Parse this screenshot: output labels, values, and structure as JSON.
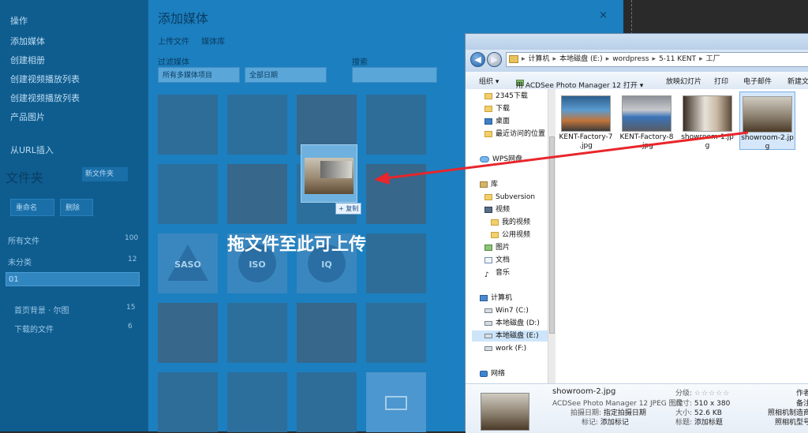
{
  "wp": {
    "sidebar_items": [
      "操作",
      "添加媒体",
      "创建相册",
      "创建视频播放列表",
      "创建视频播放列表",
      "产品图片",
      "从URL插入"
    ],
    "title": "添加媒体",
    "close": "×",
    "tabs": [
      "上传文件",
      "媒体库"
    ],
    "filter_label": "过滤媒体",
    "search_label": "搜索",
    "filter_select": "所有多媒体项目",
    "date_select": "全部日期",
    "folder_title": "文件夹",
    "new_folder": "新文件夹",
    "rename": "重命名",
    "delete": "删除",
    "folders": [
      {
        "label": "所有文件",
        "count": "100"
      },
      {
        "label": "未分类",
        "count": "12"
      }
    ],
    "search_value": "01",
    "subfolders": [
      {
        "label": "首页背景 · 尔图",
        "count": "15"
      },
      {
        "label": "下载的文件",
        "count": "6"
      }
    ],
    "logo_texts": [
      "SASO",
      "ISO",
      "IQ"
    ],
    "drop_hint": "拖文件至此可上传",
    "copy_badge": "+ 复制"
  },
  "explorer": {
    "path": [
      "计算机",
      "本地磁盘 (E:)",
      "wordpress",
      "5-11 KENT",
      "工厂"
    ],
    "toolbar": [
      "组织 ▾",
      "用 ACDSee Photo Manager 12 打开 ▾",
      "放映幻灯片",
      "打印",
      "电子邮件",
      "新建文"
    ],
    "nav": [
      {
        "label": "2345下载",
        "icon": "folder-icon",
        "group": "fav"
      },
      {
        "label": "下载",
        "icon": "folder-icon",
        "group": "fav"
      },
      {
        "label": "桌面",
        "icon": "desktop-icon",
        "group": "fav"
      },
      {
        "label": "最近访问的位置",
        "icon": "recent-icon",
        "group": "fav"
      },
      {
        "label": "WPS网盘",
        "icon": "cloud-icon",
        "group": "root"
      },
      {
        "label": "库",
        "icon": "library-icon",
        "group": "root"
      },
      {
        "label": "Subversion",
        "icon": "folder-icon",
        "group": "lib"
      },
      {
        "label": "视频",
        "icon": "video-icon",
        "group": "lib"
      },
      {
        "label": "我的视频",
        "icon": "folder-icon",
        "group": "sub"
      },
      {
        "label": "公用视频",
        "icon": "folder-icon",
        "group": "sub"
      },
      {
        "label": "图片",
        "icon": "picture-icon",
        "group": "lib"
      },
      {
        "label": "文档",
        "icon": "document-icon",
        "group": "lib"
      },
      {
        "label": "音乐",
        "icon": "music-icon",
        "group": "lib"
      },
      {
        "label": "计算机",
        "icon": "computer-icon",
        "group": "root"
      },
      {
        "label": "Win7 (C:)",
        "icon": "drive-icon",
        "group": "lib"
      },
      {
        "label": "本地磁盘 (D:)",
        "icon": "drive-icon",
        "group": "lib"
      },
      {
        "label": "本地磁盘 (E:)",
        "icon": "drive-icon",
        "group": "lib"
      },
      {
        "label": "work (F:)",
        "icon": "drive-icon",
        "group": "lib"
      },
      {
        "label": "网络",
        "icon": "network-icon",
        "group": "root"
      }
    ],
    "files": [
      {
        "name": "KENT-Factory-7.jpg",
        "line1": "KENT-Factory-7",
        "line2": ".jpg"
      },
      {
        "name": "KENT-Factory-8.jpg",
        "line1": "KENT-Factory-8",
        "line2": ".jpg"
      },
      {
        "name": "showroom-1.jpg",
        "line1": "showroom-1.jp",
        "line2": "g"
      },
      {
        "name": "showroom-2.jpg",
        "line1": "showroom-2.jp",
        "line2": "g"
      }
    ],
    "details": {
      "filename": "showroom-2.jpg",
      "type": "ACDSee Photo Manager 12 JPEG 图像",
      "date_key": "拍摄日期:",
      "date_val": "指定拍摄日期",
      "tags_key": "标记:",
      "tags_val": "添加标记",
      "rating_key": "分级:",
      "rating_val": "☆☆☆☆☆",
      "dim_key": "尺寸:",
      "dim_val": "510 x 380",
      "size_key": "大小:",
      "size_val": "52.6 KB",
      "title_key": "标题:",
      "title_val": "添加标题",
      "right_keys": [
        "作者",
        "备注",
        "照相机制造商",
        "照相机型号"
      ]
    }
  }
}
